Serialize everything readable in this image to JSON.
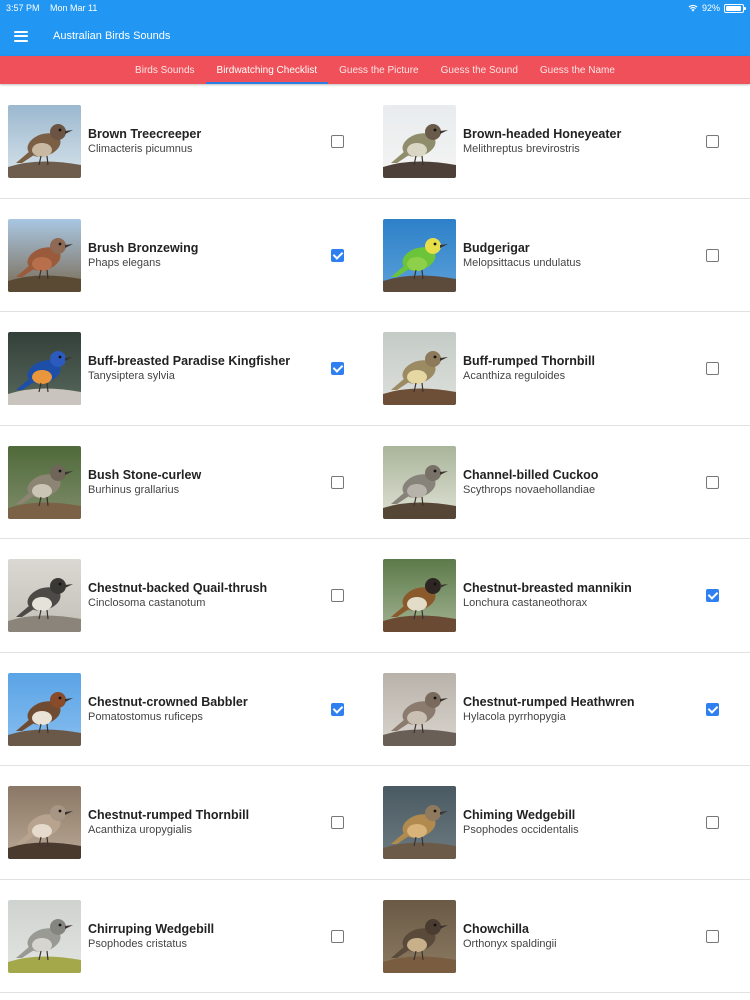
{
  "status_bar": {
    "time": "3:57 PM",
    "date": "Mon Mar 11",
    "battery": "92%",
    "battery_level": 0.92
  },
  "app": {
    "title": "Australian Birds Sounds"
  },
  "tabs": [
    {
      "label": "Birds Sounds",
      "active": false
    },
    {
      "label": "Birdwatching Checklist",
      "active": true
    },
    {
      "label": "Guess the Picture",
      "active": false
    },
    {
      "label": "Guess the Sound",
      "active": false
    },
    {
      "label": "Guess the Name",
      "active": false
    }
  ],
  "colors": {
    "appbar": "#2196f3",
    "tabbar": "#ef5059",
    "checked": "#2e7ff0"
  },
  "birds": [
    {
      "name": "Brown Treecreeper",
      "scientific": "Climacteris picumnus",
      "checked": false,
      "photo": {
        "bg": "#9bb8cf",
        "bg2": "#d7e3ea",
        "body": "#7a5f44",
        "belly": "#c9b9a3",
        "head": "#6b5443",
        "perch": "#6e5c4c"
      }
    },
    {
      "name": "Brown-headed Honeyeater",
      "scientific": "Melithreptus brevirostris",
      "checked": false,
      "photo": {
        "bg": "#e8ecef",
        "bg2": "#f4f4f2",
        "body": "#8f8d6c",
        "belly": "#d9d6c4",
        "head": "#6a5a49",
        "perch": "#4c4038"
      }
    },
    {
      "name": "Brush Bronzewing",
      "scientific": "Phaps elegans",
      "checked": true,
      "photo": {
        "bg": "#a9c7e3",
        "bg2": "#7a6b54",
        "body": "#9a5a3c",
        "belly": "#b86f4c",
        "head": "#8e6a55",
        "perch": "#5a4a34"
      }
    },
    {
      "name": "Budgerigar",
      "scientific": "Melopsittacus undulatus",
      "checked": false,
      "photo": {
        "bg": "#2d80c8",
        "bg2": "#5aa0d9",
        "body": "#6bc43a",
        "belly": "#8fd04a",
        "head": "#e6df4a",
        "perch": "#5c4a3a"
      }
    },
    {
      "name": "Buff-breasted Paradise Kingfisher",
      "scientific": "Tanysiptera sylvia",
      "checked": true,
      "photo": {
        "bg": "#33403a",
        "bg2": "#58685c",
        "body": "#1e4fa8",
        "belly": "#e9963c",
        "head": "#2c5bbf",
        "perch": "#c9c4bd"
      }
    },
    {
      "name": "Buff-rumped Thornbill",
      "scientific": "Acanthiza reguloides",
      "checked": false,
      "photo": {
        "bg": "#c4cbc6",
        "bg2": "#dde0dc",
        "body": "#9c8a63",
        "belly": "#e5d8a3",
        "head": "#8c7a5a",
        "perch": "#6c4f36"
      }
    },
    {
      "name": "Bush Stone-curlew",
      "scientific": "Burhinus grallarius",
      "checked": false,
      "photo": {
        "bg": "#4f6a3a",
        "bg2": "#7f8c6a",
        "body": "#8d8574",
        "belly": "#cbc5b6",
        "head": "#6f6659",
        "perch": "#7b6246"
      }
    },
    {
      "name": "Channel-billed Cuckoo",
      "scientific": "Scythrops novaehollandiae",
      "checked": false,
      "photo": {
        "bg": "#a9b59a",
        "bg2": "#dfe1d5",
        "body": "#87827a",
        "belly": "#b7b3aa",
        "head": "#777168",
        "perch": "#564636"
      }
    },
    {
      "name": "Chestnut-backed Quail-thrush",
      "scientific": "Cinclosoma castanotum",
      "checked": false,
      "photo": {
        "bg": "#dad8d2",
        "bg2": "#c3c0b8",
        "body": "#4c4a46",
        "belly": "#e5e2da",
        "head": "#3a3835",
        "perch": "#8a847a"
      }
    },
    {
      "name": "Chestnut-breasted mannikin",
      "scientific": "Lonchura castaneothorax",
      "checked": true,
      "photo": {
        "bg": "#5c7a4a",
        "bg2": "#a2b392",
        "body": "#8a5a2c",
        "belly": "#e3dcc9",
        "head": "#2d2622",
        "perch": "#6a4a32"
      }
    },
    {
      "name": "Chestnut-crowned Babbler",
      "scientific": "Pomatostomus ruficeps",
      "checked": true,
      "photo": {
        "bg": "#5aa4e6",
        "bg2": "#86bdef",
        "body": "#6f4b32",
        "belly": "#e9e3d8",
        "head": "#8a4b2a",
        "perch": "#6a5848"
      }
    },
    {
      "name": "Chestnut-rumped Heathwren",
      "scientific": "Hylacola pyrrhopygia",
      "checked": true,
      "photo": {
        "bg": "#b8b2aa",
        "bg2": "#d9d4cd",
        "body": "#8b7b6e",
        "belly": "#c9bfb3",
        "head": "#7a6a5d",
        "perch": "#6a5f56"
      }
    },
    {
      "name": "Chestnut-rumped Thornbill",
      "scientific": "Acanthiza uropygialis",
      "checked": false,
      "photo": {
        "bg": "#8a7765",
        "bg2": "#b9a895",
        "body": "#b8a48e",
        "belly": "#e5dacb",
        "head": "#a79683",
        "perch": "#4a3a2e"
      }
    },
    {
      "name": "Chiming Wedgebill",
      "scientific": "Psophodes occidentalis",
      "checked": false,
      "photo": {
        "bg": "#4a5a62",
        "bg2": "#6c7a80",
        "body": "#b08a4e",
        "belly": "#d8b47a",
        "head": "#8f7a5e",
        "perch": "#6c5a48"
      }
    },
    {
      "name": "Chirruping Wedgebill",
      "scientific": "Psophodes cristatus",
      "checked": false,
      "photo": {
        "bg": "#cfd3d0",
        "bg2": "#e2e4e1",
        "body": "#9a9a94",
        "belly": "#d6d5cf",
        "head": "#858580",
        "perch": "#a4a84a"
      }
    },
    {
      "name": "Chowchilla",
      "scientific": "Orthonyx spaldingii",
      "checked": false,
      "photo": {
        "bg": "#6a5a45",
        "bg2": "#8c7a62",
        "body": "#5a4a3a",
        "belly": "#c8b08a",
        "head": "#4a3c30",
        "perch": "#7a5c40"
      }
    }
  ]
}
